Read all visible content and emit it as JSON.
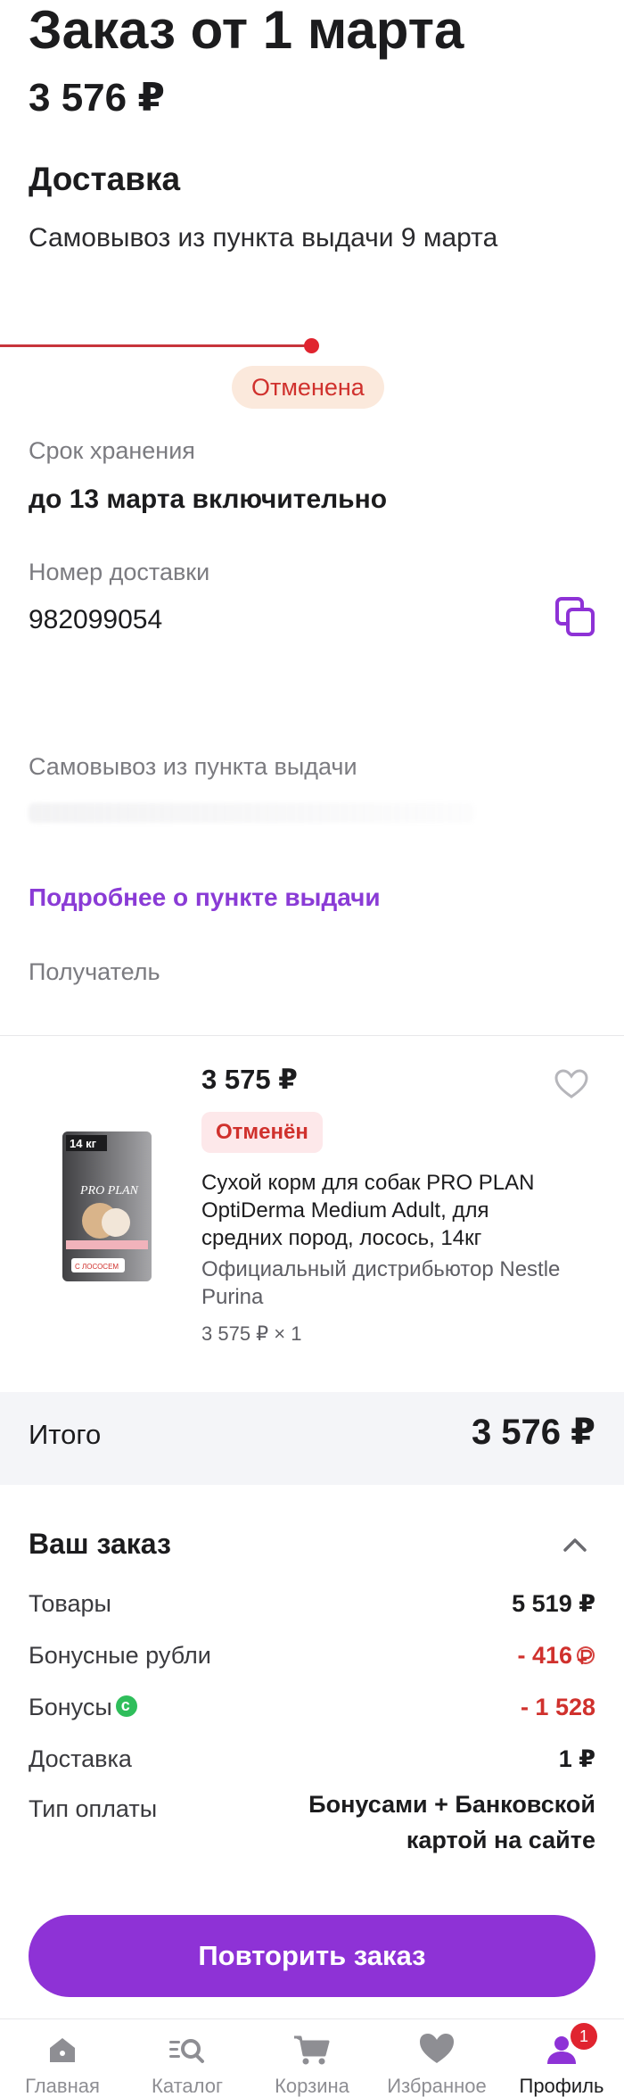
{
  "order": {
    "title": "Заказ от 1 марта",
    "sum": "3 576 ₽"
  },
  "delivery": {
    "title": "Доставка",
    "subtitle": "Самовывоз из пункта выдачи 9 марта",
    "status": "Отменена"
  },
  "storage": {
    "label": "Срок хранения",
    "value": "до 13 марта включительно"
  },
  "delivery_number": {
    "label": "Номер доставки",
    "value": "982099054"
  },
  "pickup": {
    "label": "Самовывоз из пункта выдачи",
    "more_link": "Подробнее о пункте выдачи"
  },
  "recipient": {
    "label": "Получатель"
  },
  "product": {
    "price": "3 575 ₽",
    "status": "Отменён",
    "name": "Сухой корм для собак PRO PLAN OptiDerma Medium Adult, для средних пород, лосось, 14кг",
    "seller": "Официальный дистрибьютор Nestle Purina",
    "quantity": "3 575 ₽ × 1",
    "package_weight": "14 кг",
    "package_brand": "PRO PLAN",
    "package_flavor": "С ЛОСОСЕМ"
  },
  "total": {
    "label": "Итого",
    "value": "3 576 ₽"
  },
  "summary": {
    "title": "Ваш заказ",
    "rows": [
      {
        "label": "Товары",
        "value": "5 519 ₽"
      },
      {
        "label": "Бонусные рубли",
        "value": "- 416"
      },
      {
        "label": "Бонусы",
        "value": "- 1 528"
      },
      {
        "label": "Доставка",
        "value": "1 ₽"
      }
    ],
    "payment_label": "Тип оплаты",
    "payment_value": "Бонусами + Банковской картой на сайте"
  },
  "repeat_button": "Повторить заказ",
  "tabbar": {
    "items": [
      {
        "label": "Главная",
        "icon": "home-icon"
      },
      {
        "label": "Каталог",
        "icon": "catalog-search-icon"
      },
      {
        "label": "Корзина",
        "icon": "cart-icon"
      },
      {
        "label": "Избранное",
        "icon": "heart-icon"
      },
      {
        "label": "Профиль",
        "icon": "profile-icon"
      }
    ],
    "profile_badge": "1"
  },
  "colors": {
    "accent": "#8e32d6",
    "status_red": "#d0312d",
    "bonus_green": "#2fbe5b"
  }
}
